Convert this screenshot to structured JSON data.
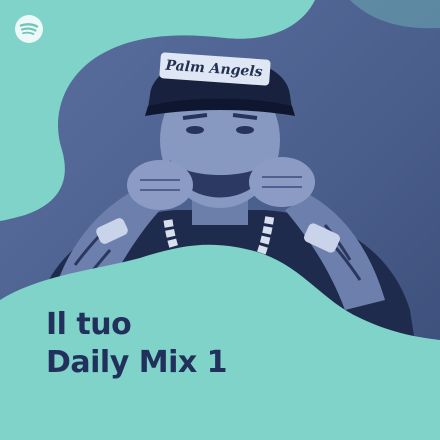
{
  "playlist": {
    "title_line1": "Il tuo",
    "title_line2": "Daily Mix 1",
    "cap_text": "Palm Angels",
    "brand_icon": "spotify-icon"
  },
  "colors": {
    "accent_mint": "#7fd3c8",
    "duotone_navy": "#22305c",
    "duotone_blue": "#4a5f8c",
    "title_text": "#22305c"
  }
}
